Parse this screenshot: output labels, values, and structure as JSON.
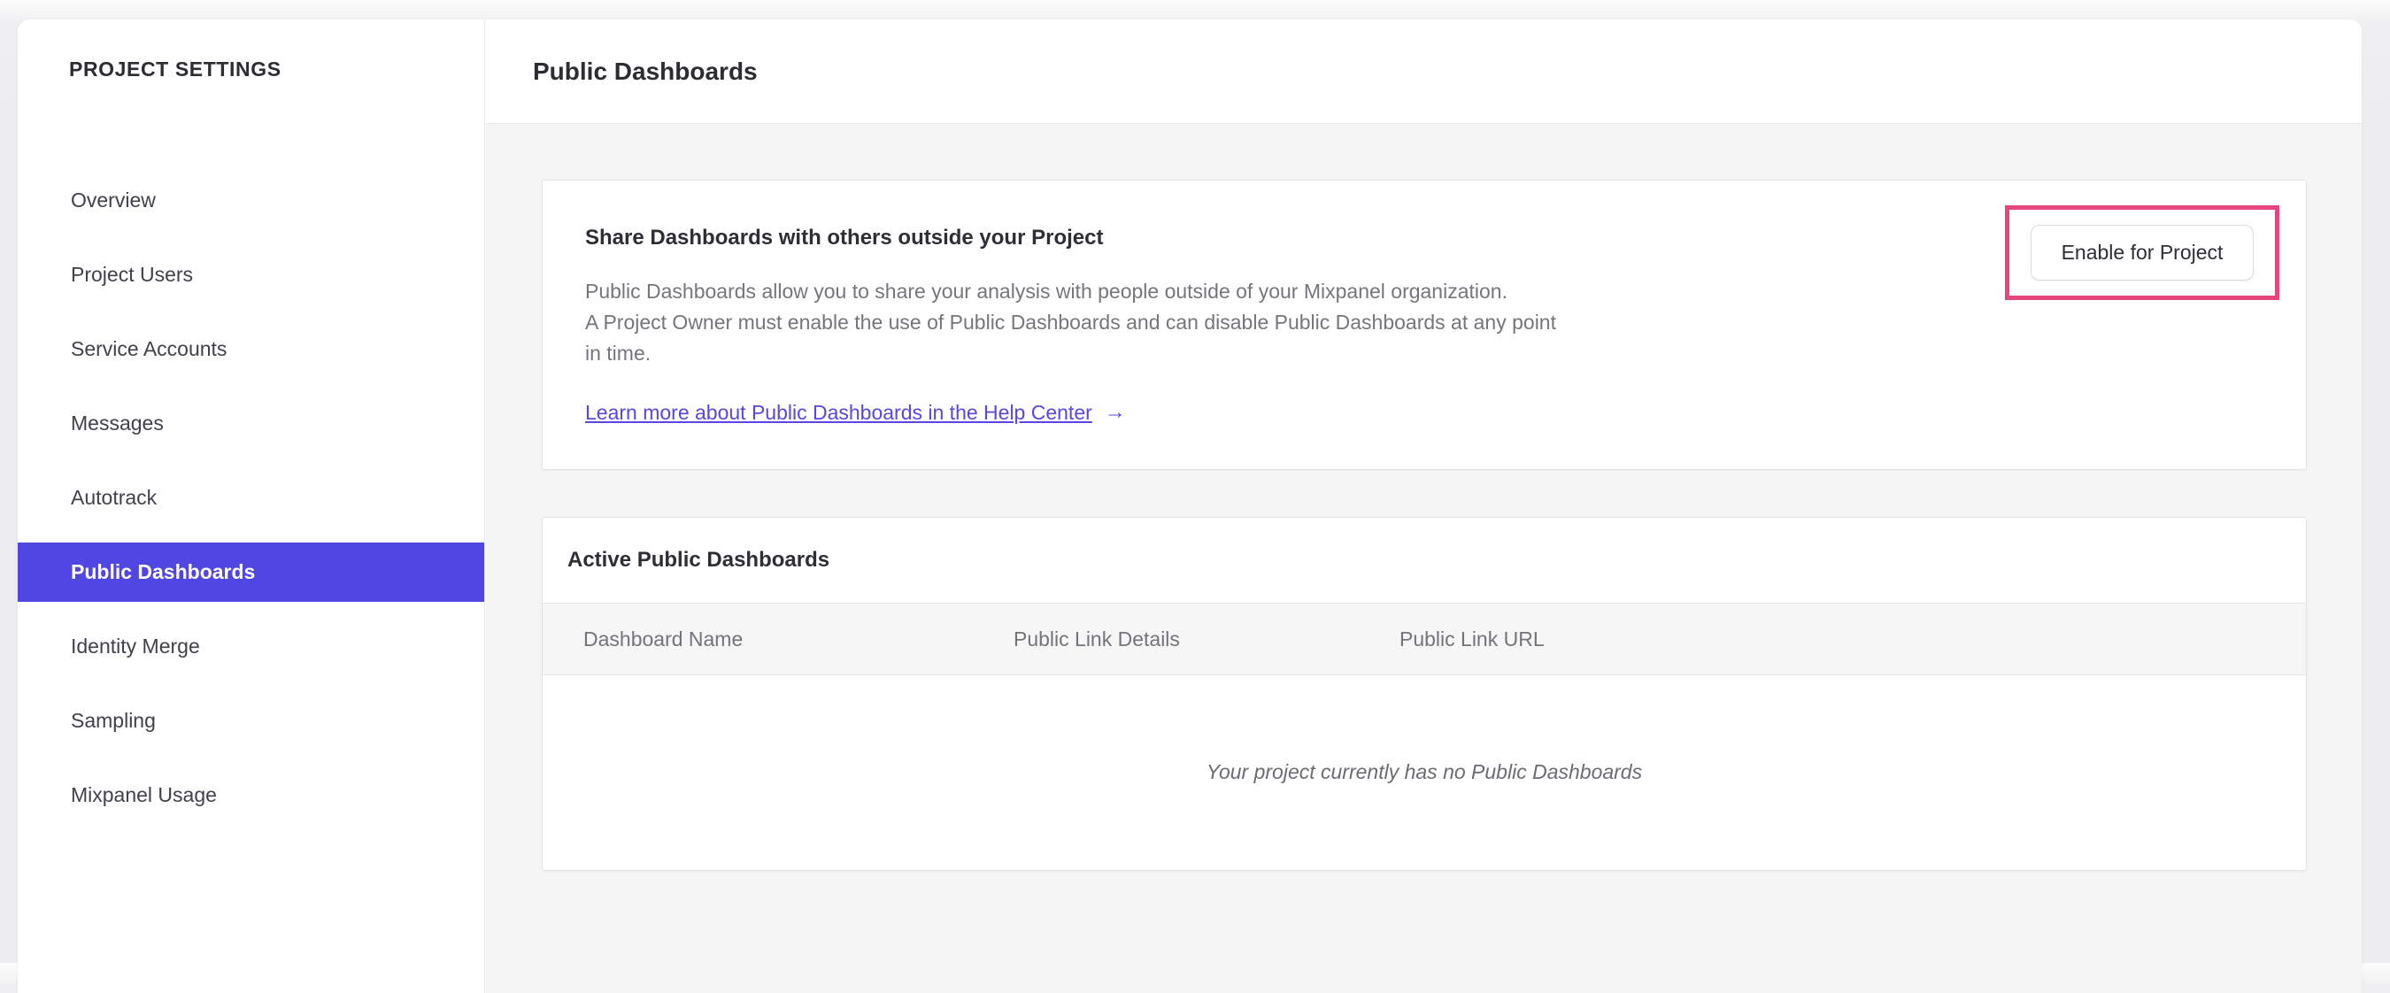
{
  "sidebar": {
    "title": "PROJECT SETTINGS",
    "items": [
      {
        "label": "Overview",
        "selected": false
      },
      {
        "label": "Project Users",
        "selected": false
      },
      {
        "label": "Service Accounts",
        "selected": false
      },
      {
        "label": "Messages",
        "selected": false
      },
      {
        "label": "Autotrack",
        "selected": false
      },
      {
        "label": "Public Dashboards",
        "selected": true
      },
      {
        "label": "Identity Merge",
        "selected": false
      },
      {
        "label": "Sampling",
        "selected": false
      },
      {
        "label": "Mixpanel Usage",
        "selected": false
      }
    ]
  },
  "header": {
    "title": "Public Dashboards"
  },
  "share_card": {
    "heading": "Share Dashboards with others outside your Project",
    "body_lines": [
      "Public Dashboards allow you to share your analysis with people outside of your Mixpanel organization.",
      "A Project Owner must enable the use of Public Dashboards and can disable Public Dashboards at any point",
      "in time."
    ],
    "link_label": "Learn more about Public Dashboards in the Help Center",
    "link_arrow": "→",
    "enable_button_label": "Enable for Project"
  },
  "active_card": {
    "heading": "Active Public Dashboards",
    "columns": [
      "Dashboard Name",
      "Public Link Details",
      "Public Link URL"
    ],
    "empty_message": "Your project currently has no Public Dashboards"
  },
  "colors": {
    "accent_purple": "#5046e2",
    "link_purple": "#5747e6",
    "annotation_pink": "#e8457f",
    "heading_text": "#2e2e36",
    "body_text": "#75757c",
    "content_background": "#f5f5f6"
  }
}
